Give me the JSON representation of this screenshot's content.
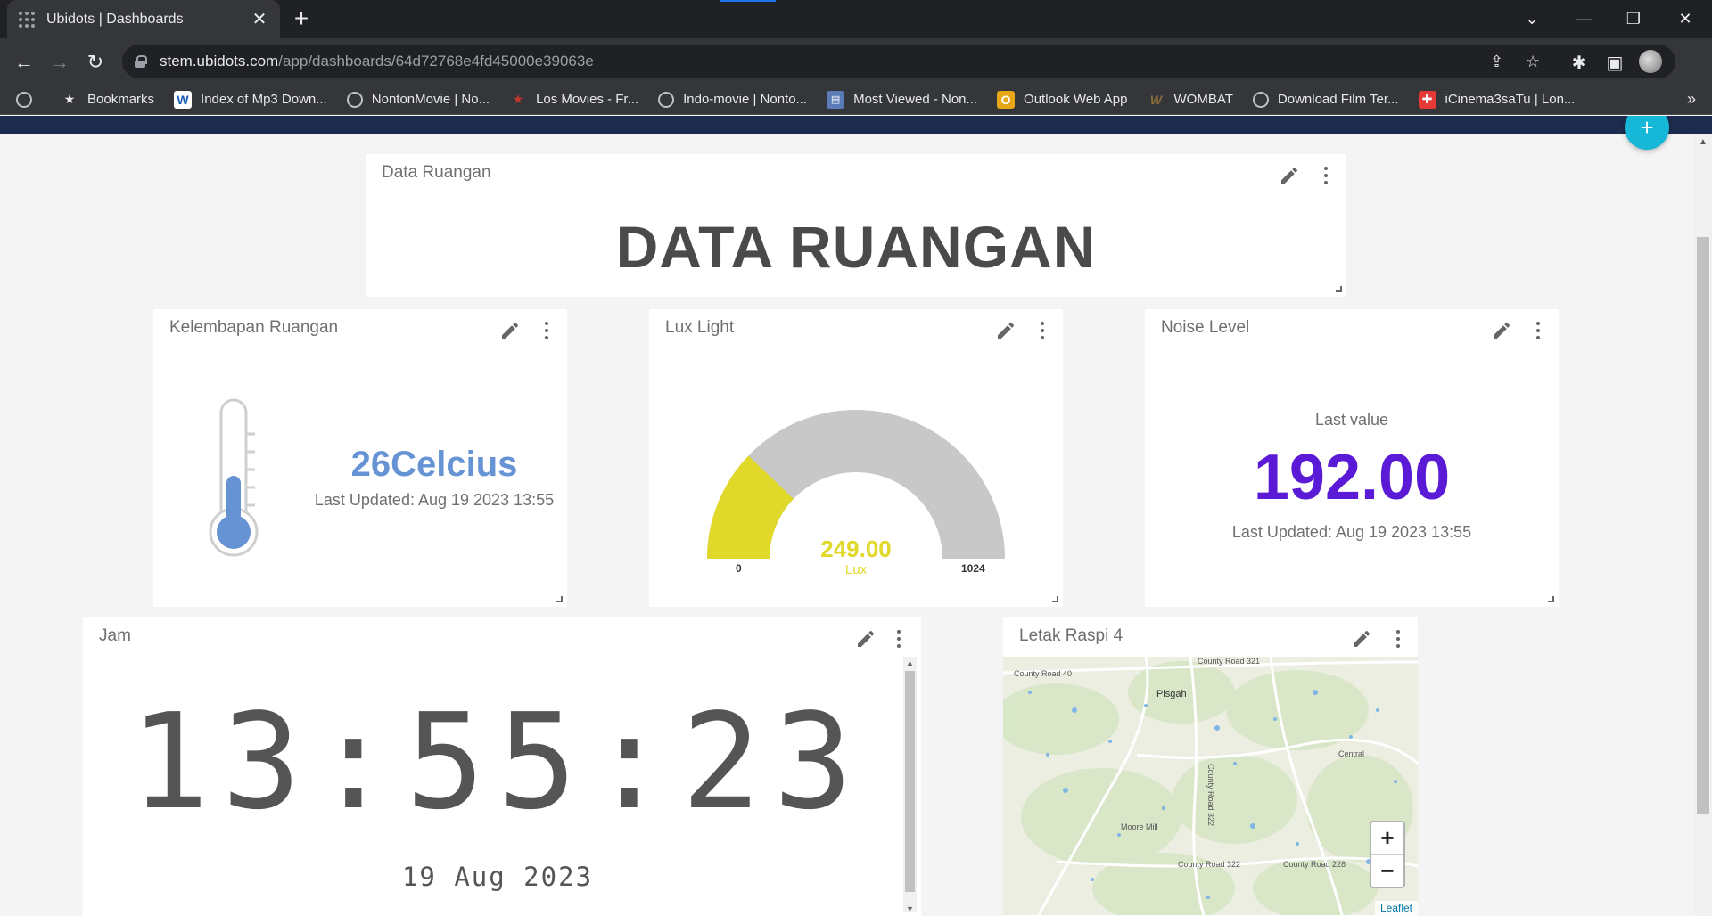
{
  "browser": {
    "tab_title": "Ubidots | Dashboards",
    "url_host": "stem.ubidots.com",
    "url_path": "/app/dashboards/64d72768e4fd45000e39063e",
    "bookmarks": [
      {
        "label": "Bookmarks",
        "icon": "star-icon"
      },
      {
        "label": "Index of Mp3 Down...",
        "icon": "w-icon"
      },
      {
        "label": "NontonMovie | No...",
        "icon": "globe-icon"
      },
      {
        "label": "Los Movies - Fr...",
        "icon": "star-film-icon"
      },
      {
        "label": "Indo-movie | Nonto...",
        "icon": "globe-icon"
      },
      {
        "label": "Most Viewed - Non...",
        "icon": "film-icon"
      },
      {
        "label": "Outlook Web App",
        "icon": "outlook-icon"
      },
      {
        "label": "WOMBAT",
        "icon": "w-icon"
      },
      {
        "label": "Download Film Ter...",
        "icon": "globe-icon"
      },
      {
        "label": "iCinema3saTu | Lon...",
        "icon": "cinema-icon"
      }
    ]
  },
  "dashboard": {
    "header_widget": {
      "title": "Data Ruangan",
      "text": "DATA RUANGAN"
    },
    "humidity_widget": {
      "title": "Kelembapan Ruangan",
      "value": "26Celcius",
      "updated": "Last Updated: Aug 19 2023 13:55",
      "level": 0.45
    },
    "lux_widget": {
      "title": "Lux Light",
      "value": "249.00",
      "unit": "Lux",
      "min": "0",
      "max": "1024",
      "numeric_value": 249,
      "numeric_min": 0,
      "numeric_max": 1024
    },
    "noise_widget": {
      "title": "Noise Level",
      "label": "Last value",
      "value": "192.00",
      "updated": "Last Updated: Aug 19 2023 13:55"
    },
    "clock_widget": {
      "title": "Jam",
      "time": "13:55:23",
      "date": "19 Aug 2023"
    },
    "map_widget": {
      "title": "Letak Raspi 4",
      "attribution": "Leaflet",
      "labels": [
        "County Road 40",
        "County Road 321",
        "Pisgah",
        "County Road 322",
        "Central",
        "Moore Mill",
        "County Road 322",
        "County Road 228"
      ]
    }
  },
  "colors": {
    "header_navy": "#1d2b4f",
    "fab_cyan": "#17b7d8",
    "temp_blue": "#6693d4",
    "gauge_yellow": "#e0d929",
    "gauge_gray": "#c8c8c8",
    "noise_purple": "#5a1ad6"
  }
}
